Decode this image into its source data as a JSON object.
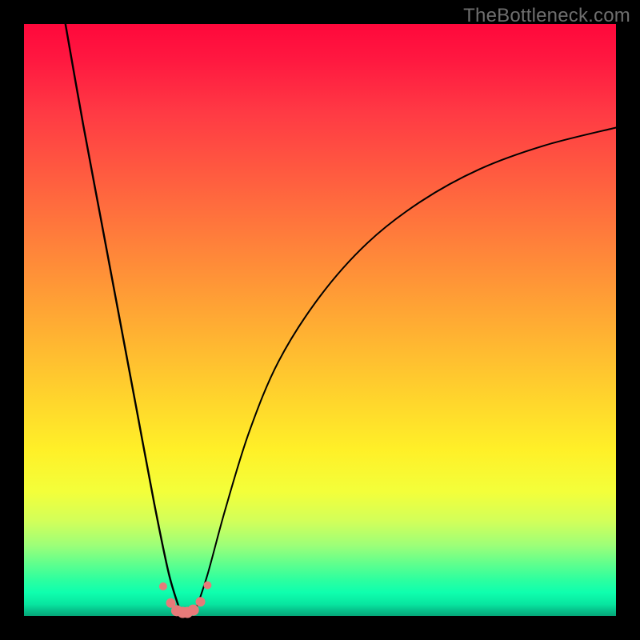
{
  "attribution": "TheBottleneck.com",
  "colors": {
    "frame": "#000000",
    "curve": "#000000",
    "marker_fill": "#e77a79",
    "marker_stroke": "#d65a58",
    "gradient_stops": [
      "#ff083b",
      "#ff6a3e",
      "#ffca2e",
      "#f3ff3a",
      "#2bffa0",
      "#05a678"
    ]
  },
  "chart_data": {
    "type": "line",
    "title": "",
    "xlabel": "",
    "ylabel": "",
    "xlim": [
      0,
      100
    ],
    "ylim": [
      0,
      100
    ],
    "grid": false,
    "legend": false,
    "note": "Axes are unlabeled; values are estimated from pixel positions as percentages of plot area. y≈0 is the bottom (green), y≈100 is the top (red). The left branch descends from the top-left toward a trough near x≈27, then the right branch rises with diminishing slope toward the top right.",
    "series": [
      {
        "name": "left-branch",
        "x": [
          7,
          10,
          13,
          16,
          19,
          22,
          24.5,
          26.5
        ],
        "y": [
          100,
          83,
          67,
          51,
          35,
          19,
          7,
          0.5
        ]
      },
      {
        "name": "right-branch",
        "x": [
          29,
          31,
          34,
          38,
          43,
          50,
          58,
          67,
          77,
          88,
          100
        ],
        "y": [
          1,
          7,
          18,
          31,
          43,
          54,
          63,
          70,
          75.5,
          79.5,
          82.5
        ]
      }
    ],
    "markers": {
      "name": "trough-cluster",
      "x": [
        23.5,
        24.8,
        25.8,
        26.8,
        27.6,
        28.6,
        29.8,
        31.0
      ],
      "y": [
        5.0,
        2.2,
        0.9,
        0.6,
        0.6,
        1.0,
        2.4,
        5.2
      ],
      "r": [
        5,
        6,
        7,
        7,
        7,
        7,
        6,
        5
      ]
    }
  }
}
